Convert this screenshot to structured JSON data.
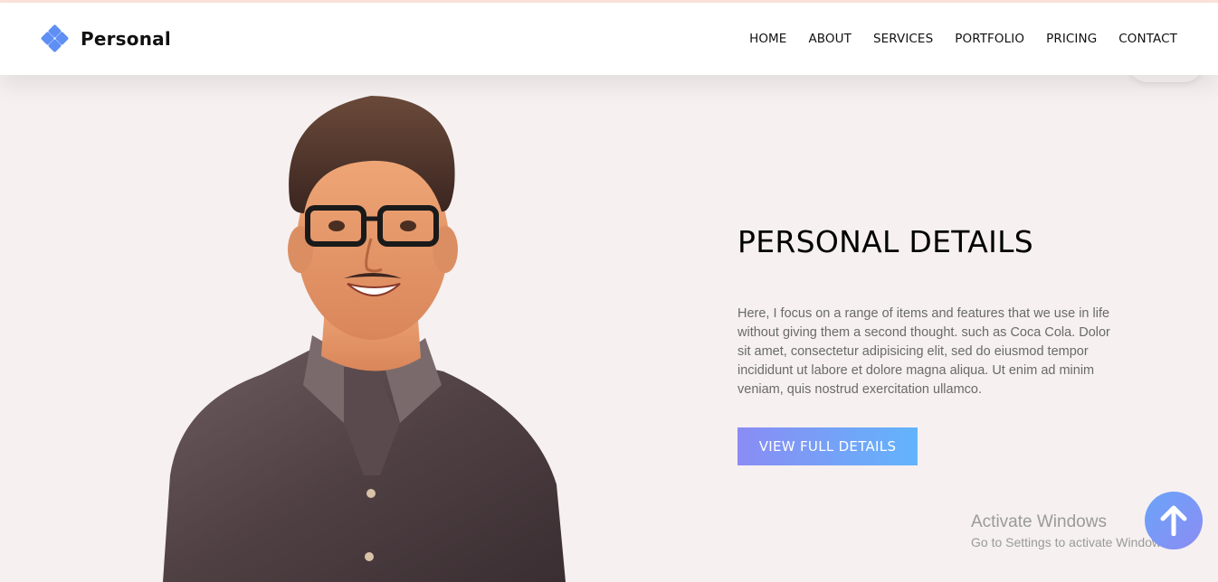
{
  "brand": {
    "name": "Personal",
    "logo_icon": "diamond-cluster-icon"
  },
  "nav": {
    "items": [
      "HOME",
      "ABOUT",
      "SERVICES",
      "PORTFOLIO",
      "PRICING",
      "CONTACT"
    ]
  },
  "hero": {
    "title": "PERSONAL DETAILS",
    "description": "Here, I focus on a range of items and features that we use in life without giving them a second thought. such as Coca Cola. Dolor sit amet, consectetur adipisicing elit, sed do eiusmod tempor incididunt ut labore et dolore magna aliqua. Ut enim ad minim veniam, quis nostrud exercitation ullamco.",
    "button_label": "VIEW FULL DETAILS",
    "image": "portrait-illustration"
  },
  "watermark": {
    "line1": "Activate Windows",
    "line2": "Go to Settings to activate Windows."
  },
  "scroll_top_icon": "arrow-up-icon",
  "colors": {
    "background": "#f6f0f0",
    "accent_start": "#8a8cf4",
    "accent_end": "#62b4fb",
    "logo": "#5f8ff5"
  }
}
